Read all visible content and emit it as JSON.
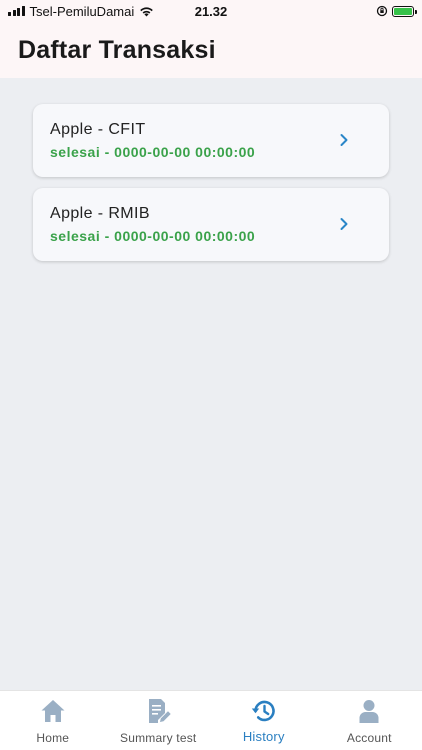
{
  "status": {
    "carrier": "Tsel-PemiluDamai",
    "time": "21.32"
  },
  "header": {
    "title": "Daftar Transaksi"
  },
  "transactions": [
    {
      "title": "Apple - CFIT",
      "status": "selesai - 0000-00-00 00:00:00"
    },
    {
      "title": "Apple - RMIB",
      "status": "selesai - 0000-00-00 00:00:00"
    }
  ],
  "tabs": [
    {
      "label": "Home",
      "icon": "home-icon"
    },
    {
      "label": "Summary test",
      "icon": "document-edit-icon"
    },
    {
      "label": "History",
      "icon": "history-icon",
      "active": true
    },
    {
      "label": "Account",
      "icon": "person-icon"
    }
  ],
  "colors": {
    "accent": "#2a7fc1",
    "success": "#3aa24a",
    "header_bg": "#fdf6f7",
    "body_bg": "#eceef2"
  }
}
